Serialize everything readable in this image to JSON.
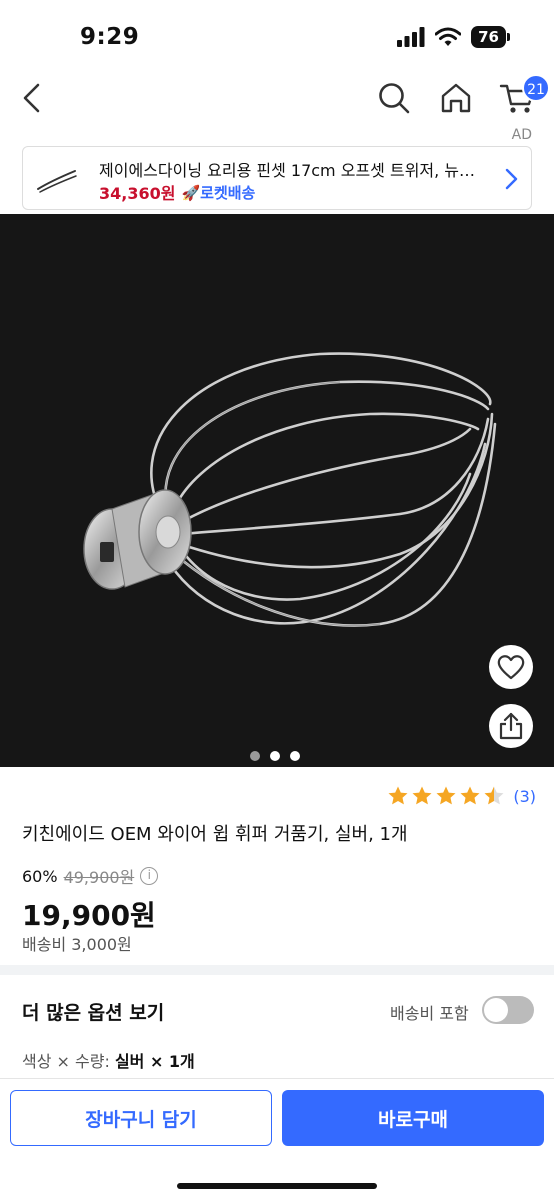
{
  "status": {
    "time": "9:29",
    "battery": "76"
  },
  "nav": {
    "cart_count": "21",
    "ad_label": "AD"
  },
  "ad": {
    "title": "제이에스다이닝 요리용 핀셋 17cm 오프셋 트위저, 뉴…",
    "price": "34,360원",
    "rocket_label": "🚀로켓배송"
  },
  "product": {
    "rating_value": 4.5,
    "rating_count": "(3)",
    "title": "키친에이드 OEM 와이어 윕 휘퍼 거품기, 실버, 1개",
    "discount_rate": "60%",
    "original_price": "49,900원",
    "sale_price": "19,900원",
    "shipping_fee": "배송비 3,000원",
    "image_count": 3,
    "active_image_index": 0
  },
  "options": {
    "more_options_label": "더 많은 옵션 보기",
    "shipping_include_label": "배송비 포함",
    "shipping_include_on": false,
    "option_label": "색상 × 수량: ",
    "option_value": "실버 × 1개"
  },
  "buttons": {
    "add_to_cart": "장바구니 담기",
    "buy_now": "바로구매"
  },
  "colors": {
    "accent": "#346aff",
    "ad_price": "#c8102e",
    "star": "#f5a623"
  }
}
